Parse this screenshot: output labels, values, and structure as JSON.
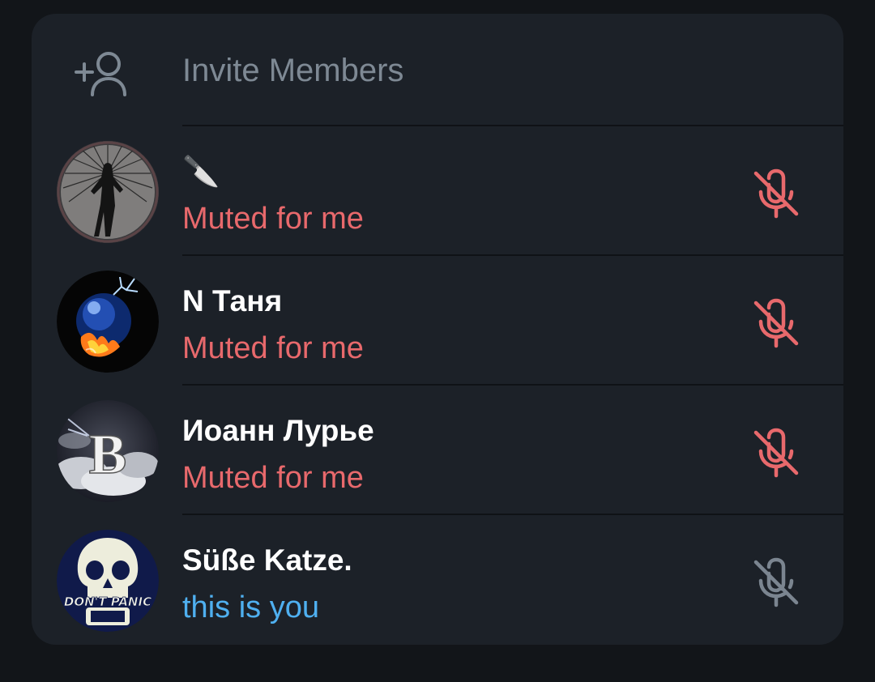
{
  "invite": {
    "label": "Invite Members",
    "icon": "add-user-icon"
  },
  "members": [
    {
      "name": "🔪",
      "status": "Muted for me",
      "status_kind": "muted",
      "avatar": "dark-figure-avatar",
      "mic_icon": "mic-off-icon",
      "mic_color": "#e8696c"
    },
    {
      "name": "N Таня",
      "status": "Muted for me",
      "status_kind": "muted",
      "avatar": "blue-fire-sphere-avatar",
      "mic_icon": "mic-off-icon",
      "mic_color": "#e8696c"
    },
    {
      "name": "Иоанн Лурье",
      "status": "Muted for me",
      "status_kind": "muted",
      "avatar": "letter-b-clouds-avatar",
      "avatar_letter": "B",
      "mic_icon": "mic-off-icon",
      "mic_color": "#e8696c"
    },
    {
      "name": "Süße Katze.",
      "status": "this is you",
      "status_kind": "you",
      "avatar": "skull-dont-panic-avatar",
      "avatar_text": "DON'T PANIC",
      "mic_icon": "mic-off-icon",
      "mic_color": "#7b8590"
    }
  ],
  "colors": {
    "background": "#121519",
    "panel": "#1c2128",
    "muted": "#e8696c",
    "you": "#4fb0f0",
    "secondary": "#7e8994"
  }
}
